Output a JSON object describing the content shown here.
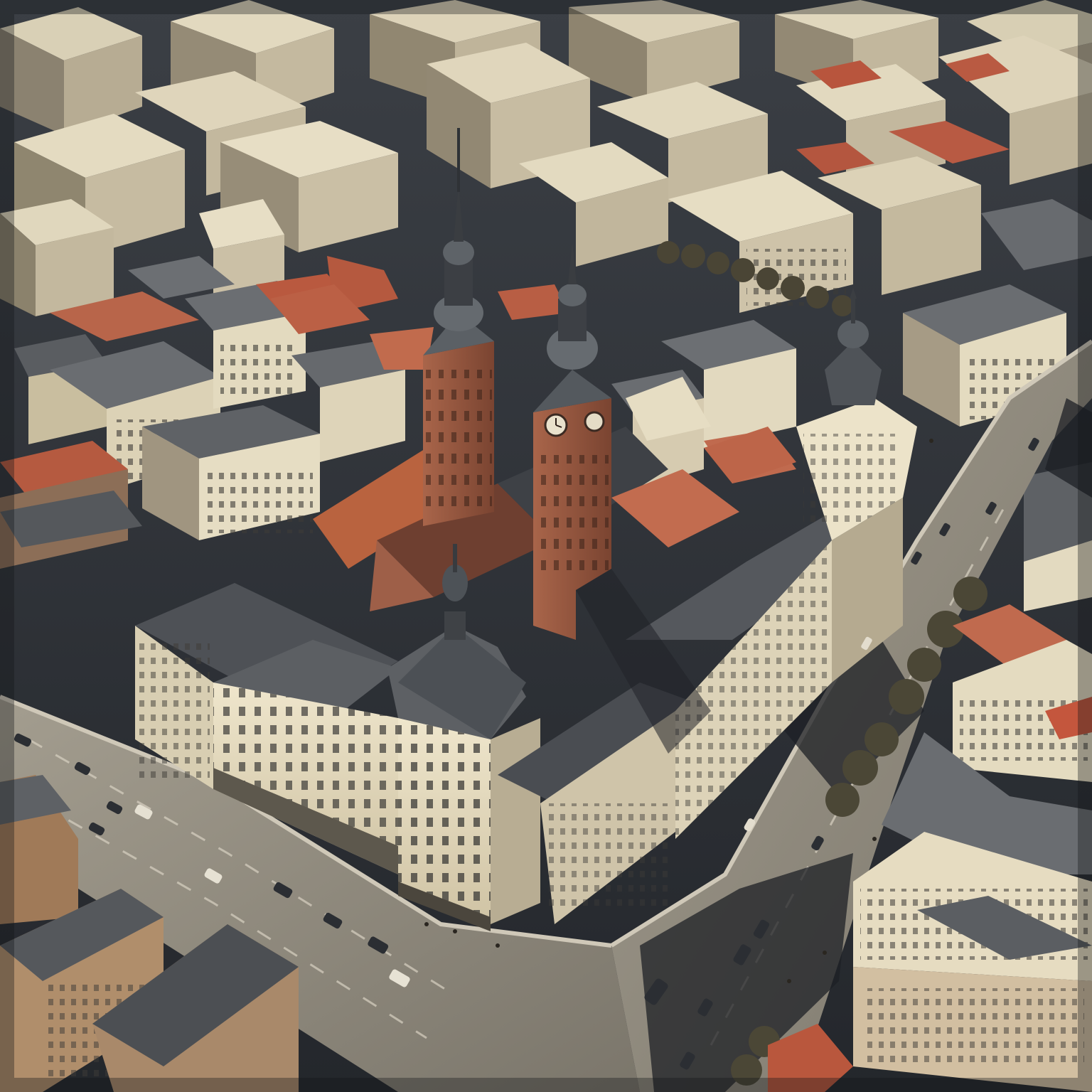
{
  "scene": {
    "palette": {
      "sky_shadow": "#1c1f24",
      "street": "#8e8a80",
      "street_light": "#b9b3a5",
      "roof_gray": "#5f6266",
      "roof_dark": "#3a3d42",
      "facade_cream": "#e8dfc6",
      "facade_shadow": "#9a8f79",
      "tower_brick": "#9a5a3f",
      "tower_brick_dark": "#6e3c2a",
      "roof_terracotta": "#c06a4e",
      "roof_copper": "#4b5257",
      "tree_dark": "#3e3a2c",
      "car": "#2a2d31"
    }
  }
}
